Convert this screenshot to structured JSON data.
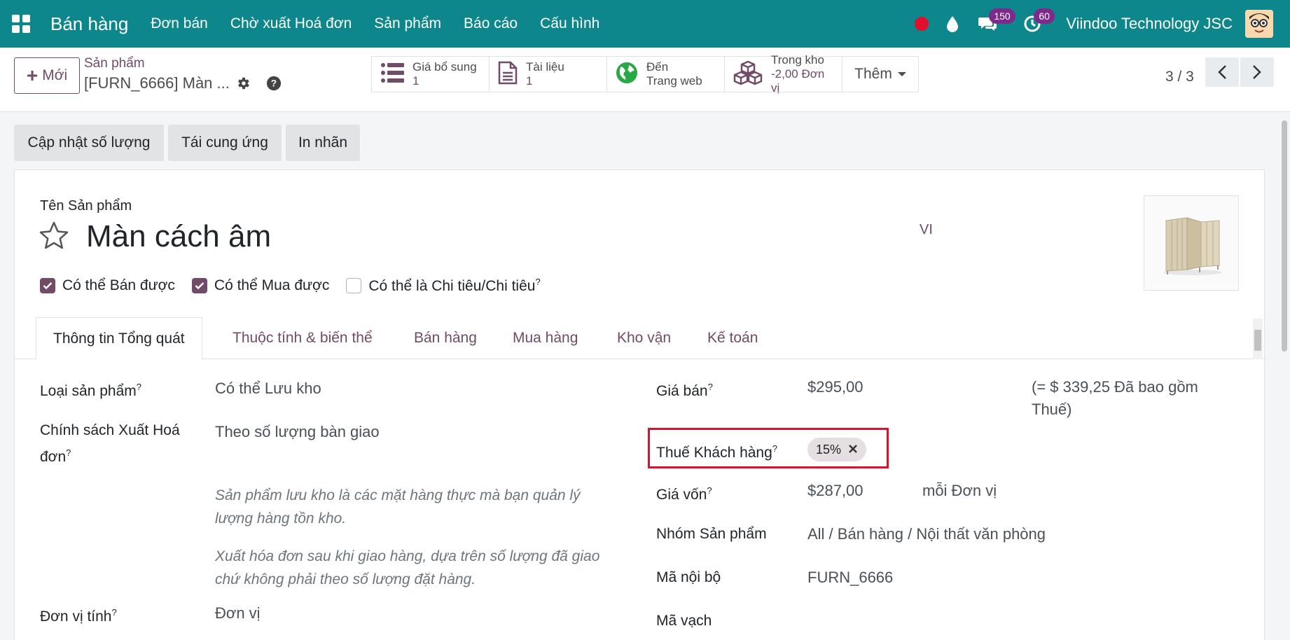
{
  "navbar": {
    "brand": "Bán hàng",
    "menu": [
      "Đơn bán",
      "Chờ xuất Hoá đơn",
      "Sản phẩm",
      "Báo cáo",
      "Cấu hình"
    ],
    "messages_count": "150",
    "activities_count": "60",
    "company": "Viindoo Technology JSC"
  },
  "control": {
    "new_label": "Mới",
    "breadcrumb_parent": "Sản phẩm",
    "breadcrumb_current": "[FURN_6666] Màn ...",
    "smart_buttons": [
      {
        "icon": "list-icon",
        "title": "Giá bổ sung",
        "value": "1"
      },
      {
        "icon": "document-icon",
        "title": "Tài liệu",
        "value": "1"
      },
      {
        "icon": "globe-icon",
        "title": "Đến",
        "value": "Trang web"
      },
      {
        "icon": "cubes-icon",
        "title": "Trong kho",
        "value": "-2,00 Đơn vị"
      }
    ],
    "more_label": "Thêm",
    "pager": "3 / 3"
  },
  "actions": [
    "Cập nhật số lượng",
    "Tái cung ứng",
    "In nhãn"
  ],
  "form": {
    "name_label": "Tên Sản phẩm",
    "name": "Màn cách âm",
    "lang": "VI",
    "checkboxes": [
      {
        "label": "Có thể Bán được",
        "checked": true
      },
      {
        "label": "Có thể Mua được",
        "checked": true
      },
      {
        "label": "Có thể là Chi tiêu/Chi tiêu",
        "checked": false
      }
    ],
    "tabs": [
      "Thông tin Tổng quát",
      "Thuộc tính & biến thể",
      "Bán hàng",
      "Mua hàng",
      "Kho vận",
      "Kế toán"
    ],
    "left": {
      "product_type_label": "Loại sản phẩm",
      "product_type": "Có thể Lưu kho",
      "invoice_policy_label_1": "Chính sách Xuất Hoá",
      "invoice_policy_label_2": "đơn",
      "invoice_policy": "Theo số lượng bàn giao",
      "help_1_line1": "Sản phẩm lưu kho là các mặt hàng thực mà bạn quản lý",
      "help_1_line2": "lượng hàng tồn kho.",
      "help_2_line1": "Xuất hóa đơn sau khi giao hàng, dựa trên số lượng đã giao",
      "help_2_line2": "chứ không phải theo số lượng đặt hàng.",
      "uom_label": "Đơn vị tính",
      "uom": "Đơn vị"
    },
    "right": {
      "sale_price_label": "Giá bán",
      "sale_price": "$295,00",
      "tax_included_line1": "(= $ 339,25 Đã bao gồm",
      "tax_included_line2": "Thuế)",
      "customer_tax_label": "Thuế Khách hàng",
      "customer_tax": "15%",
      "cost_label": "Giá vốn",
      "cost": "$287,00",
      "cost_unit": "mỗi Đơn vị",
      "category_label": "Nhóm Sản phẩm",
      "category": "All / Bán hàng / Nội thất văn phòng",
      "internal_ref_label": "Mã nội bộ",
      "internal_ref": "FURN_6666",
      "barcode_label": "Mã vạch"
    },
    "help_marker": "?"
  }
}
